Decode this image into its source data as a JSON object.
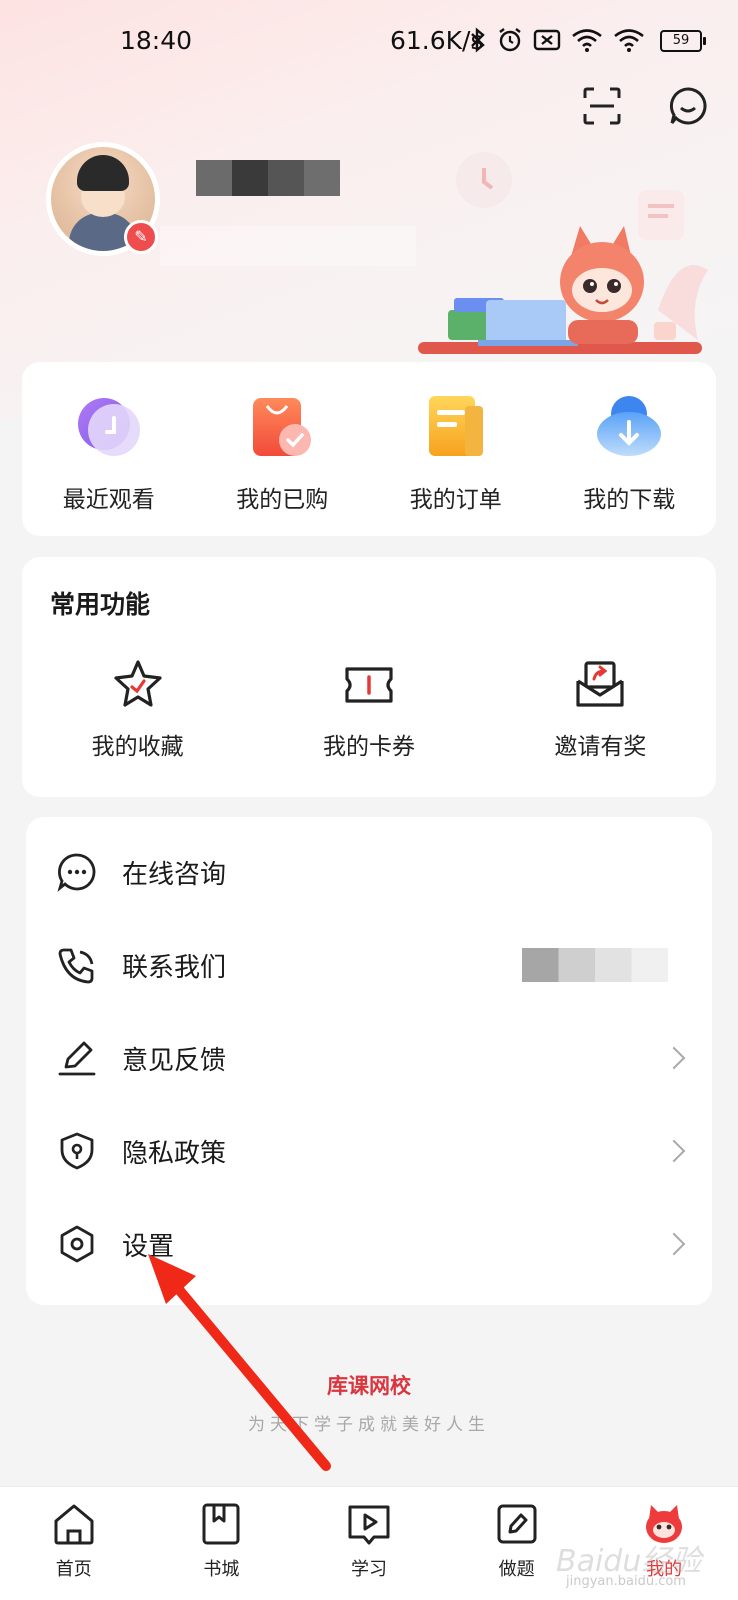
{
  "status_bar": {
    "time": "18:40",
    "network_speed": "61.6K/s",
    "battery": "59",
    "icons": [
      "bluetooth-icon",
      "alarm-icon",
      "sim-off-icon",
      "wifi-icon",
      "wifi-icon",
      "battery-icon"
    ]
  },
  "header": {
    "actions": [
      "scan-icon",
      "message-icon"
    ],
    "colors": {
      "accent": "#ef4d4d",
      "brand": "#d9363e"
    }
  },
  "quick_access": [
    {
      "label": "最近观看",
      "icon": "recent-clock-icon"
    },
    {
      "label": "我的已购",
      "icon": "purchased-bag-icon"
    },
    {
      "label": "我的订单",
      "icon": "order-list-icon"
    },
    {
      "label": "我的下载",
      "icon": "download-cloud-icon"
    }
  ],
  "common_functions": {
    "title": "常用功能",
    "items": [
      {
        "label": "我的收藏",
        "icon": "star-icon"
      },
      {
        "label": "我的卡券",
        "icon": "ticket-icon"
      },
      {
        "label": "邀请有奖",
        "icon": "invite-mail-icon"
      }
    ]
  },
  "menu": [
    {
      "label": "在线咨询",
      "icon": "chat-bubble-icon"
    },
    {
      "label": "联系我们",
      "icon": "phone-icon"
    },
    {
      "label": "意见反馈",
      "icon": "feedback-edit-icon"
    },
    {
      "label": "隐私政策",
      "icon": "shield-icon"
    },
    {
      "label": "设置",
      "icon": "settings-hexagon-icon"
    }
  ],
  "brand": {
    "name": "库课网校",
    "slogan": "为天下学子成就美好人生"
  },
  "tabbar": [
    {
      "label": "首页",
      "icon": "home-icon"
    },
    {
      "label": "书城",
      "icon": "book-icon"
    },
    {
      "label": "学习",
      "icon": "play-icon"
    },
    {
      "label": "做题",
      "icon": "edit-icon"
    },
    {
      "label": "我的",
      "icon": "mascot-icon",
      "active": true
    }
  ],
  "watermark": {
    "text": "Baidu经验",
    "url_text": "jingyan.baidu.com"
  }
}
